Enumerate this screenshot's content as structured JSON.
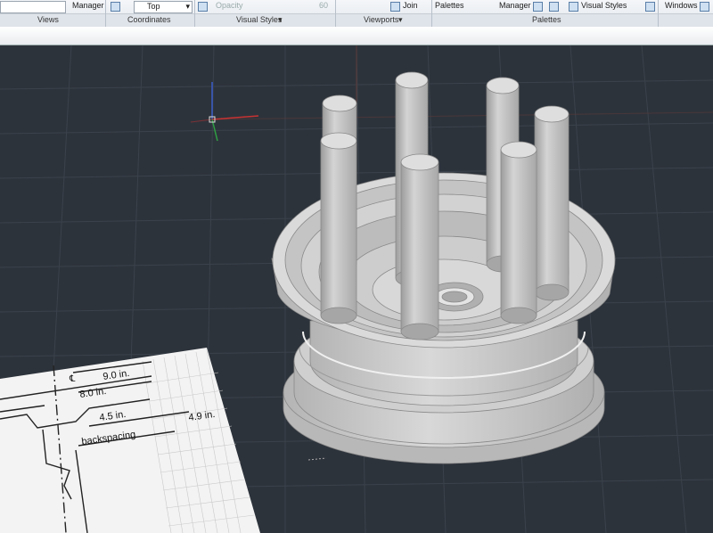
{
  "ribbon": {
    "row_items": {
      "manager_1": "Manager",
      "view_select": "Top",
      "opacity_label": "Opacity",
      "opacity_value": "60",
      "join": "Join",
      "palettes": "Palettes",
      "manager_2": "Manager",
      "visual_styles_btn": "Visual Styles",
      "windows": "Windows"
    },
    "panels": {
      "views": "Views",
      "coordinates": "Coordinates",
      "visual_styles": "Visual Styles",
      "viewports": "Viewports",
      "palettes": "Palettes"
    }
  },
  "drawing": {
    "dim_1": "9.0 in.",
    "dim_2": "8.0 in.",
    "dim_3": "4.5 in.",
    "dim_4": "4.9 in.",
    "dim_5": "backspacing"
  },
  "colors": {
    "viewport_bg": "#2d333b",
    "grid_line": "#3b424b",
    "model": "#c8c8c8",
    "ucs_x": "#c83232",
    "ucs_y": "#2ea043",
    "ucs_z": "#3a5cc9"
  }
}
